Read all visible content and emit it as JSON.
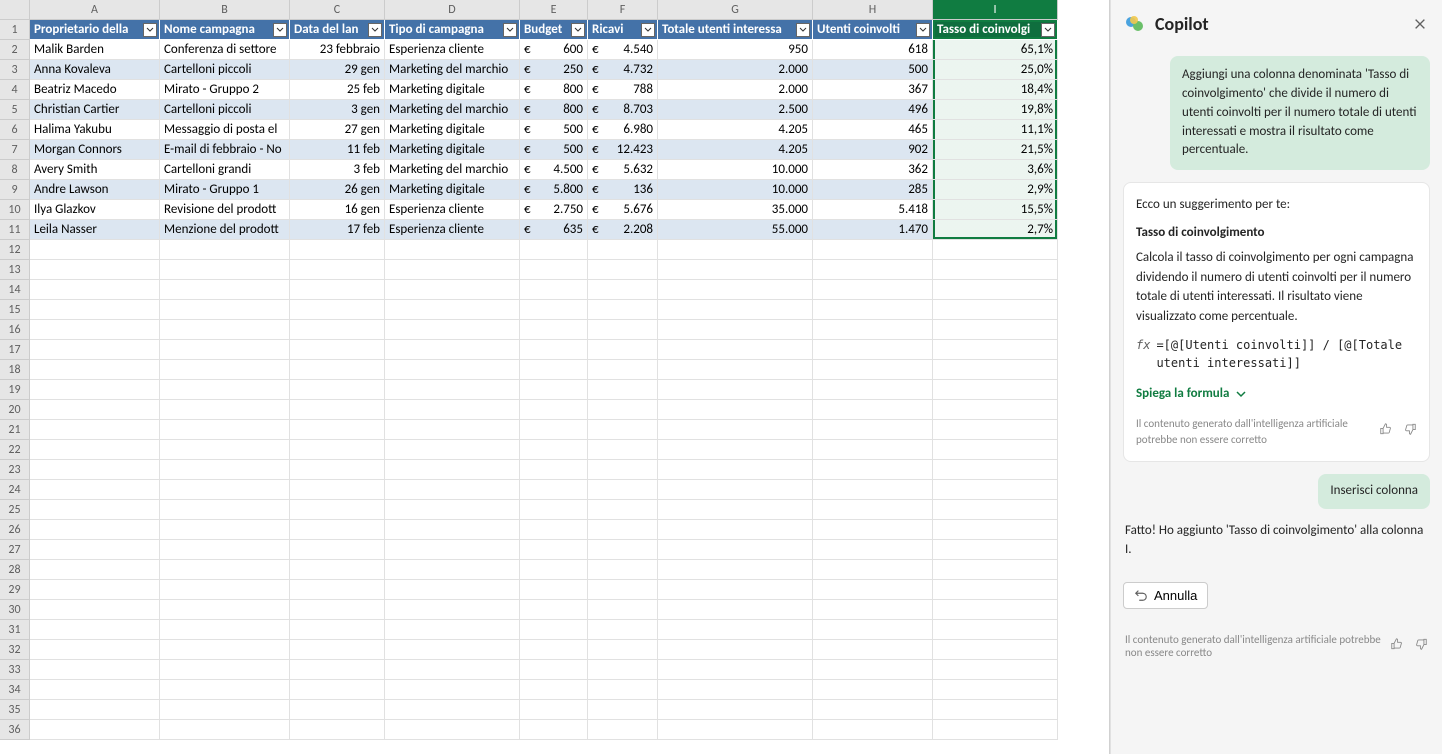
{
  "columns": [
    "A",
    "B",
    "C",
    "D",
    "E",
    "F",
    "G",
    "H",
    "I"
  ],
  "col_widths": [
    "w-A",
    "w-B",
    "w-C",
    "w-D",
    "w-E",
    "w-F",
    "w-G",
    "w-H",
    "w-I"
  ],
  "headers": {
    "A": "Proprietario della",
    "B": "Nome campagna",
    "C": "Data del lan",
    "D": "Tipo di campagna",
    "E": "Budget",
    "F": "Ricavi",
    "G": "Totale utenti interessa",
    "H": "Utenti coinvolti",
    "I": "Tasso di coinvolgi"
  },
  "selected_col": "I",
  "currency": "€",
  "rows": [
    {
      "A": "Malik Barden",
      "B": "Conferenza di settore",
      "C": "23 febbraio",
      "D": "Esperienza cliente",
      "E": "600",
      "F": "4.540",
      "G": "950",
      "H": "618",
      "I": "65,1%"
    },
    {
      "A": "Anna Kovaleva",
      "B": "Cartelloni piccoli",
      "C": "29 gen",
      "D": "Marketing del marchio",
      "E": "250",
      "F": "4.732",
      "G": "2.000",
      "H": "500",
      "I": "25,0%"
    },
    {
      "A": "Beatriz Macedo",
      "B": "Mirato - Gruppo 2",
      "C": "25 feb",
      "D": "Marketing digitale",
      "E": "800",
      "F": "788",
      "G": "2.000",
      "H": "367",
      "I": "18,4%"
    },
    {
      "A": "Christian Cartier",
      "B": "Cartelloni piccoli",
      "C": "3 gen",
      "D": "Marketing del marchio",
      "E": "800",
      "F": "8.703",
      "G": "2.500",
      "H": "496",
      "I": "19,8%"
    },
    {
      "A": "Halima Yakubu",
      "B": "Messaggio di posta el",
      "C": "27 gen",
      "D": "Marketing digitale",
      "E": "500",
      "F": "6.980",
      "G": "4.205",
      "H": "465",
      "I": "11,1%"
    },
    {
      "A": "Morgan Connors",
      "B": "E-mail di febbraio - No",
      "C": "11 feb",
      "D": "Marketing digitale",
      "E": "500",
      "F": "12.423",
      "G": "4.205",
      "H": "902",
      "I": "21,5%"
    },
    {
      "A": "Avery Smith",
      "B": "Cartelloni grandi",
      "C": "3 feb",
      "D": "Marketing del marchio",
      "E": "4.500",
      "F": "5.632",
      "G": "10.000",
      "H": "362",
      "I": "3,6%"
    },
    {
      "A": "Andre Lawson",
      "B": "Mirato - Gruppo 1",
      "C": "26 gen",
      "D": "Marketing digitale",
      "E": "5.800",
      "F": "136",
      "G": "10.000",
      "H": "285",
      "I": "2,9%"
    },
    {
      "A": "Ilya Glazkov",
      "B": "Revisione del prodott",
      "C": "16 gen",
      "D": "Esperienza cliente",
      "E": "2.750",
      "F": "5.676",
      "G": "35.000",
      "H": "5.418",
      "I": "15,5%"
    },
    {
      "A": "Leila Nasser",
      "B": "Menzione del prodott",
      "C": "17 feb",
      "D": "Esperienza cliente",
      "E": "635",
      "F": "2.208",
      "G": "55.000",
      "H": "1.470",
      "I": "2,7%"
    }
  ],
  "empty_rows": 25,
  "copilot": {
    "title": "Copilot",
    "user_prompt": "Aggiungi una colonna denominata 'Tasso di coinvolgimento' che divide il numero di utenti coinvolti per il numero totale di utenti interessati e mostra il risultato come percentuale.",
    "suggestion_intro": "Ecco un suggerimento per te:",
    "suggestion_title": "Tasso di coinvolgimento",
    "suggestion_body": "Calcola il tasso di coinvolgimento per ogni campagna dividendo il numero di utenti coinvolti per il numero totale di utenti interessati. Il risultato viene visualizzato come percentuale.",
    "formula_fx": "fx",
    "formula": "=[@[Utenti coinvolti]] / [@[Totale utenti interessati]]",
    "explain_label": "Spiega la formula",
    "disclaimer": "Il contenuto generato dall'intelligenza artificiale potrebbe non essere corretto",
    "insert_label": "Inserisci colonna",
    "done_text": "Fatto! Ho aggiunto 'Tasso di coinvolgimento' alla colonna I.",
    "undo_label": "Annulla"
  }
}
